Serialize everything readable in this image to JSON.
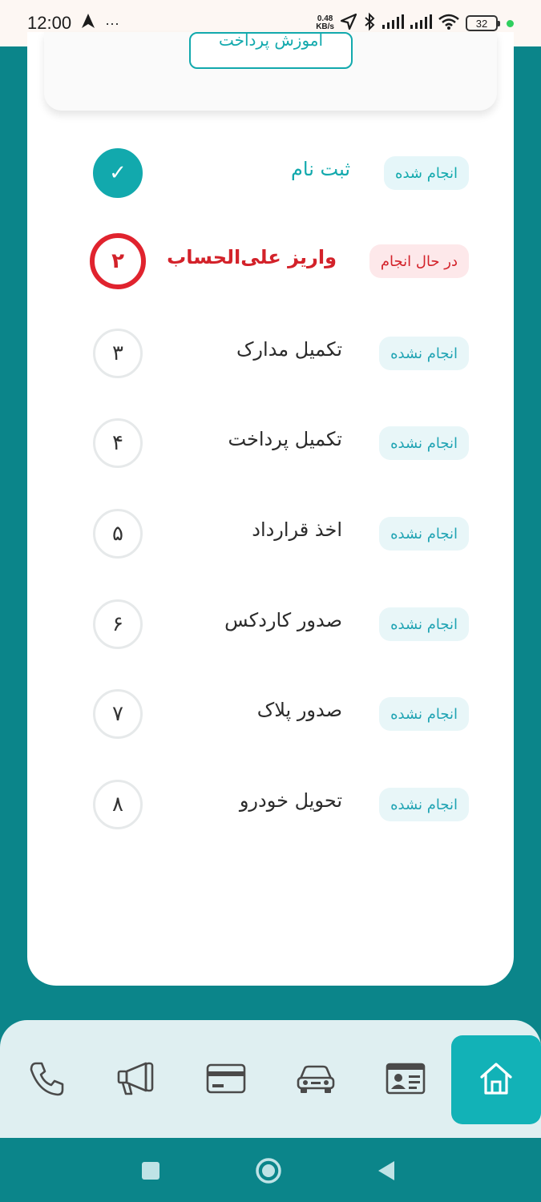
{
  "status_bar": {
    "time": "12:00",
    "more": "···",
    "speed_value": "0.48",
    "speed_unit": "KB/s",
    "battery": "32"
  },
  "top_card": {
    "button_label": "آموزش پرداخت"
  },
  "steps": [
    {
      "number": "✓",
      "title": "ثبت نام",
      "status": "انجام شده",
      "state": "done"
    },
    {
      "number": "۲",
      "title": "واریز علی‌الحساب",
      "status": "در حال انجام",
      "state": "active"
    },
    {
      "number": "۳",
      "title": "تکمیل مدارک",
      "status": "انجام نشده",
      "state": "pending"
    },
    {
      "number": "۴",
      "title": "تکمیل پرداخت",
      "status": "انجام نشده",
      "state": "pending"
    },
    {
      "number": "۵",
      "title": "اخذ قرارداد",
      "status": "انجام نشده",
      "state": "pending"
    },
    {
      "number": "۶",
      "title": "صدور کاردکس",
      "status": "انجام نشده",
      "state": "pending"
    },
    {
      "number": "۷",
      "title": "صدور پلاک",
      "status": "انجام نشده",
      "state": "pending"
    },
    {
      "number": "۸",
      "title": "تحویل خودرو",
      "status": "انجام نشده",
      "state": "pending"
    }
  ],
  "bottom_nav": [
    {
      "icon": "phone-icon"
    },
    {
      "icon": "megaphone-icon"
    },
    {
      "icon": "credit-card-icon"
    },
    {
      "icon": "car-icon"
    },
    {
      "icon": "id-card-icon"
    },
    {
      "icon": "home-icon",
      "active": true
    }
  ],
  "colors": {
    "teal": "#12a9ad",
    "red": "#d3222a",
    "background": "#0b858a"
  }
}
